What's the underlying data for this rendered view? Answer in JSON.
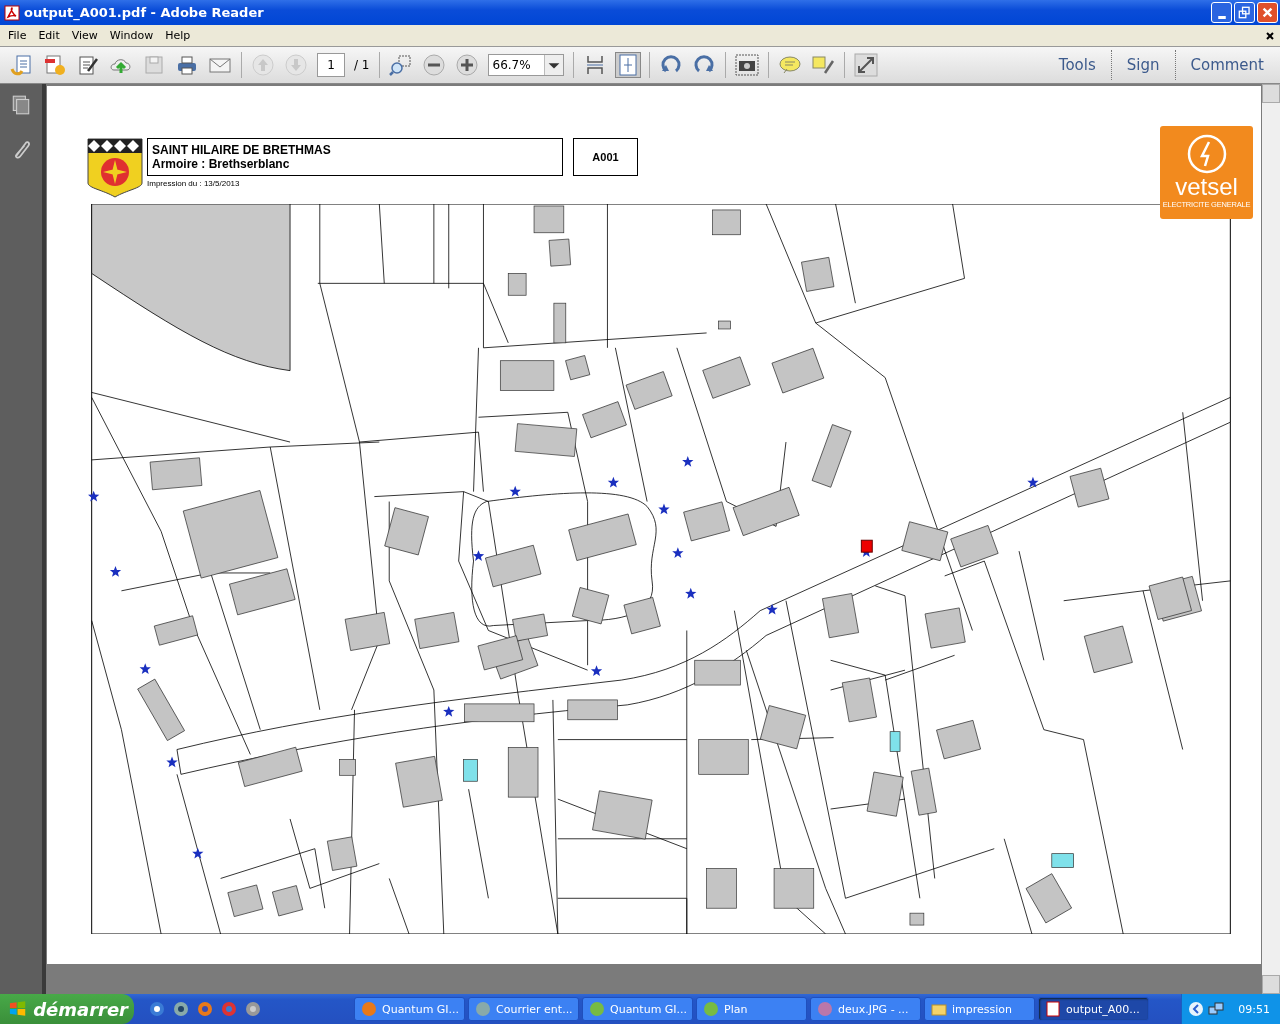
{
  "window": {
    "title": "output_A001.pdf - Adobe Reader"
  },
  "menu": [
    "File",
    "Edit",
    "View",
    "Window",
    "Help"
  ],
  "toolbar": {
    "page": "1",
    "page_total": "/ 1",
    "zoom": "66.7%",
    "panels": [
      "Tools",
      "Sign",
      "Comment"
    ]
  },
  "document": {
    "commune": "SAINT HILAIRE DE BRETHMAS",
    "cabinet": "Armoire : Brethserblanc",
    "code": "A001",
    "print_date": "Impression du : 13/5/2013",
    "logo": {
      "name": "vetsel",
      "tagline": "ELECTRICITE GENERALE"
    }
  },
  "taskbar": {
    "start": "démarrer",
    "tasks": [
      {
        "label": "Quantum GI...",
        "selected": false
      },
      {
        "label": "Courrier ent...",
        "selected": false
      },
      {
        "label": "Quantum GI...",
        "selected": false
      },
      {
        "label": "Plan",
        "selected": false
      },
      {
        "label": "deux.JPG - ...",
        "selected": false
      },
      {
        "label": "impression",
        "selected": false
      },
      {
        "label": "output_A00...",
        "selected": true
      }
    ],
    "clock": "09:51"
  }
}
